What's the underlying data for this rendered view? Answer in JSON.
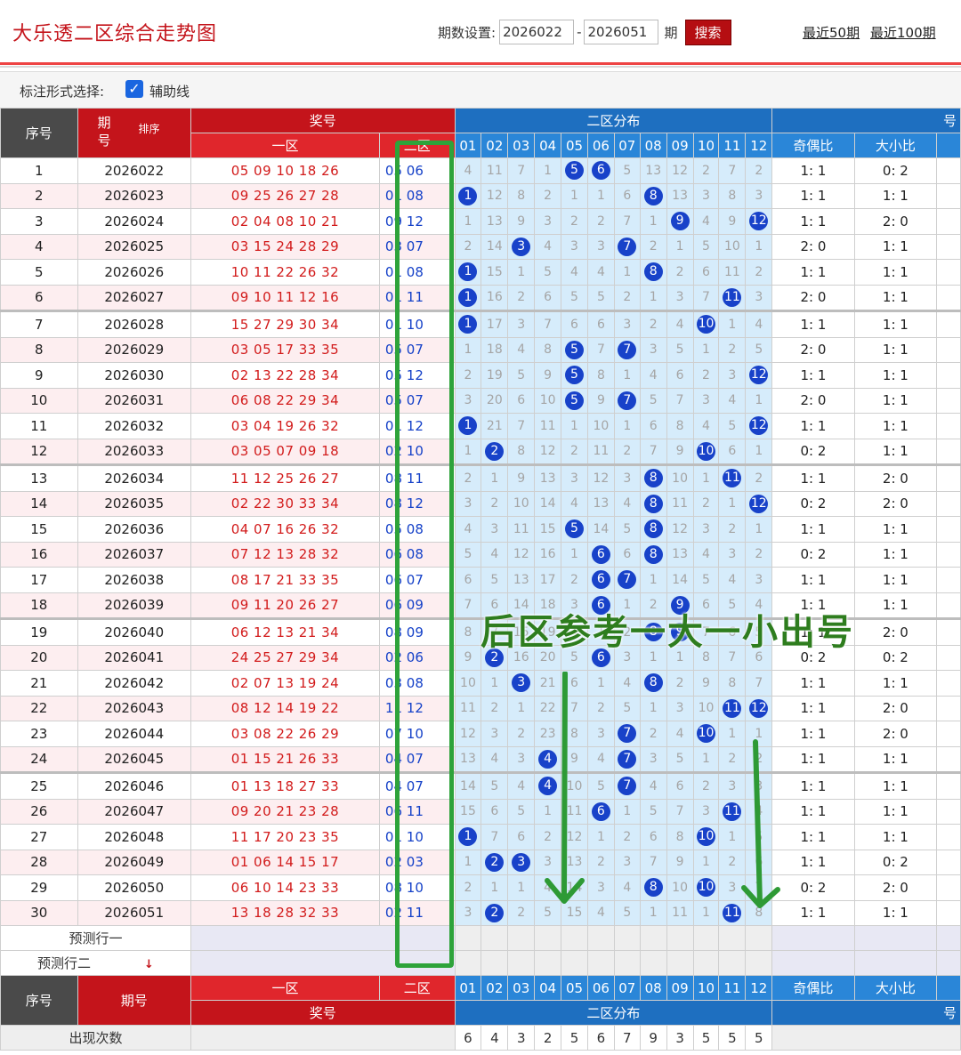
{
  "header": {
    "title": "大乐透二区综合走势图",
    "period_label": "期数设置:",
    "period_from": "2026022",
    "period_to": "2026051",
    "period_unit": "期",
    "search_label": "搜索",
    "recent_50": "最近50期",
    "recent_100": "最近100期"
  },
  "options": {
    "label": "标注形式选择:",
    "aux_line_label": "辅助线",
    "aux_line_checked": true
  },
  "table_header": {
    "idx": "序号",
    "period": "期\n号",
    "sort": "排序",
    "prize": "奖号",
    "zone1": "一区",
    "zone2": "二区",
    "dist": "二区分布",
    "odd_even": "奇偶比",
    "big_small": "大小比",
    "cols": [
      "01",
      "02",
      "03",
      "04",
      "05",
      "06",
      "07",
      "08",
      "09",
      "10",
      "11",
      "12"
    ]
  },
  "rows": [
    {
      "idx": "1",
      "period": "2026022",
      "z1": "05 09 10 18 26",
      "z2": "05 06",
      "cells": [
        "4",
        "11",
        "7",
        "1",
        "5",
        "6",
        "5",
        "13",
        "12",
        "2",
        "7",
        "2"
      ],
      "hits": [
        5,
        6
      ],
      "oe": "1: 1",
      "bs": "0: 2"
    },
    {
      "idx": "2",
      "period": "2026023",
      "z1": "09 25 26 27 28",
      "z2": "01 08",
      "cells": [
        "1",
        "12",
        "8",
        "2",
        "1",
        "1",
        "6",
        "8",
        "13",
        "3",
        "8",
        "3"
      ],
      "hits": [
        1,
        8
      ],
      "oe": "1: 1",
      "bs": "1: 1"
    },
    {
      "idx": "3",
      "period": "2026024",
      "z1": "02 04 08 10 21",
      "z2": "09 12",
      "cells": [
        "1",
        "13",
        "9",
        "3",
        "2",
        "2",
        "7",
        "1",
        "9",
        "4",
        "9",
        "12"
      ],
      "hits": [
        9,
        12
      ],
      "oe": "1: 1",
      "bs": "2: 0"
    },
    {
      "idx": "4",
      "period": "2026025",
      "z1": "03 15 24 28 29",
      "z2": "03 07",
      "cells": [
        "2",
        "14",
        "3",
        "4",
        "3",
        "3",
        "7",
        "2",
        "1",
        "5",
        "10",
        "1"
      ],
      "hits": [
        3,
        7
      ],
      "oe": "2: 0",
      "bs": "1: 1"
    },
    {
      "idx": "5",
      "period": "2026026",
      "z1": "10 11 22 26 32",
      "z2": "01 08",
      "cells": [
        "1",
        "15",
        "1",
        "5",
        "4",
        "4",
        "1",
        "8",
        "2",
        "6",
        "11",
        "2"
      ],
      "hits": [
        1,
        8
      ],
      "oe": "1: 1",
      "bs": "1: 1"
    },
    {
      "idx": "6",
      "period": "2026027",
      "z1": "09 10 11 12 16",
      "z2": "01 11",
      "cells": [
        "1",
        "16",
        "2",
        "6",
        "5",
        "5",
        "2",
        "1",
        "3",
        "7",
        "11",
        "3"
      ],
      "hits": [
        1,
        11
      ],
      "oe": "2: 0",
      "bs": "1: 1"
    },
    {
      "idx": "7",
      "period": "2026028",
      "z1": "15 27 29 30 34",
      "z2": "01 10",
      "cells": [
        "1",
        "17",
        "3",
        "7",
        "6",
        "6",
        "3",
        "2",
        "4",
        "10",
        "1",
        "4"
      ],
      "hits": [
        1,
        10
      ],
      "oe": "1: 1",
      "bs": "1: 1"
    },
    {
      "idx": "8",
      "period": "2026029",
      "z1": "03 05 17 33 35",
      "z2": "05 07",
      "cells": [
        "1",
        "18",
        "4",
        "8",
        "5",
        "7",
        "7",
        "3",
        "5",
        "1",
        "2",
        "5"
      ],
      "hits": [
        5,
        7
      ],
      "oe": "2: 0",
      "bs": "1: 1"
    },
    {
      "idx": "9",
      "period": "2026030",
      "z1": "02 13 22 28 34",
      "z2": "05 12",
      "cells": [
        "2",
        "19",
        "5",
        "9",
        "5",
        "8",
        "1",
        "4",
        "6",
        "2",
        "3",
        "12"
      ],
      "hits": [
        5,
        12
      ],
      "oe": "1: 1",
      "bs": "1: 1"
    },
    {
      "idx": "10",
      "period": "2026031",
      "z1": "06 08 22 29 34",
      "z2": "05 07",
      "cells": [
        "3",
        "20",
        "6",
        "10",
        "5",
        "9",
        "7",
        "5",
        "7",
        "3",
        "4",
        "1"
      ],
      "hits": [
        5,
        7
      ],
      "oe": "2: 0",
      "bs": "1: 1"
    },
    {
      "idx": "11",
      "period": "2026032",
      "z1": "03 04 19 26 32",
      "z2": "01 12",
      "cells": [
        "1",
        "21",
        "7",
        "11",
        "1",
        "10",
        "1",
        "6",
        "8",
        "4",
        "5",
        "12"
      ],
      "hits": [
        1,
        12
      ],
      "oe": "1: 1",
      "bs": "1: 1"
    },
    {
      "idx": "12",
      "period": "2026033",
      "z1": "03 05 07 09 18",
      "z2": "02 10",
      "cells": [
        "1",
        "2",
        "8",
        "12",
        "2",
        "11",
        "2",
        "7",
        "9",
        "10",
        "6",
        "1"
      ],
      "hits": [
        2,
        10
      ],
      "oe": "0: 2",
      "bs": "1: 1"
    },
    {
      "idx": "13",
      "period": "2026034",
      "z1": "11 12 25 26 27",
      "z2": "08 11",
      "cells": [
        "2",
        "1",
        "9",
        "13",
        "3",
        "12",
        "3",
        "8",
        "10",
        "1",
        "11",
        "2"
      ],
      "hits": [
        8,
        11
      ],
      "oe": "1: 1",
      "bs": "2: 0"
    },
    {
      "idx": "14",
      "period": "2026035",
      "z1": "02 22 30 33 34",
      "z2": "08 12",
      "cells": [
        "3",
        "2",
        "10",
        "14",
        "4",
        "13",
        "4",
        "8",
        "11",
        "2",
        "1",
        "12"
      ],
      "hits": [
        8,
        12
      ],
      "oe": "0: 2",
      "bs": "2: 0"
    },
    {
      "idx": "15",
      "period": "2026036",
      "z1": "04 07 16 26 32",
      "z2": "05 08",
      "cells": [
        "4",
        "3",
        "11",
        "15",
        "5",
        "14",
        "5",
        "8",
        "12",
        "3",
        "2",
        "1"
      ],
      "hits": [
        5,
        8
      ],
      "oe": "1: 1",
      "bs": "1: 1"
    },
    {
      "idx": "16",
      "period": "2026037",
      "z1": "07 12 13 28 32",
      "z2": "06 08",
      "cells": [
        "5",
        "4",
        "12",
        "16",
        "1",
        "6",
        "6",
        "8",
        "13",
        "4",
        "3",
        "2"
      ],
      "hits": [
        6,
        8
      ],
      "oe": "0: 2",
      "bs": "1: 1"
    },
    {
      "idx": "17",
      "period": "2026038",
      "z1": "08 17 21 33 35",
      "z2": "06 07",
      "cells": [
        "6",
        "5",
        "13",
        "17",
        "2",
        "6",
        "7",
        "1",
        "14",
        "5",
        "4",
        "3"
      ],
      "hits": [
        6,
        7
      ],
      "oe": "1: 1",
      "bs": "1: 1"
    },
    {
      "idx": "18",
      "period": "2026039",
      "z1": "09 11 20 26 27",
      "z2": "06 09",
      "cells": [
        "7",
        "6",
        "14",
        "18",
        "3",
        "6",
        "1",
        "2",
        "9",
        "6",
        "5",
        "4"
      ],
      "hits": [
        6,
        9
      ],
      "oe": "1: 1",
      "bs": "1: 1"
    },
    {
      "idx": "19",
      "period": "2026040",
      "z1": "06 12 13 21 34",
      "z2": "08 09",
      "cells": [
        "8",
        "7",
        "15",
        "19",
        "4",
        "1",
        "2",
        "8",
        "9",
        "7",
        "6",
        "5"
      ],
      "hits": [
        8,
        9
      ],
      "oe": "1: 1",
      "bs": "2: 0"
    },
    {
      "idx": "20",
      "period": "2026041",
      "z1": "24 25 27 29 34",
      "z2": "02 06",
      "cells": [
        "9",
        "2",
        "16",
        "20",
        "5",
        "6",
        "3",
        "1",
        "1",
        "8",
        "7",
        "6"
      ],
      "hits": [
        2,
        6
      ],
      "oe": "0: 2",
      "bs": "0: 2"
    },
    {
      "idx": "21",
      "period": "2026042",
      "z1": "02 07 13 19 24",
      "z2": "03 08",
      "cells": [
        "10",
        "1",
        "3",
        "21",
        "6",
        "1",
        "4",
        "8",
        "2",
        "9",
        "8",
        "7"
      ],
      "hits": [
        3,
        8
      ],
      "oe": "1: 1",
      "bs": "1: 1"
    },
    {
      "idx": "22",
      "period": "2026043",
      "z1": "08 12 14 19 22",
      "z2": "11 12",
      "cells": [
        "11",
        "2",
        "1",
        "22",
        "7",
        "2",
        "5",
        "1",
        "3",
        "10",
        "11",
        "12"
      ],
      "hits": [
        11,
        12
      ],
      "oe": "1: 1",
      "bs": "2: 0"
    },
    {
      "idx": "23",
      "period": "2026044",
      "z1": "03 08 22 26 29",
      "z2": "07 10",
      "cells": [
        "12",
        "3",
        "2",
        "23",
        "8",
        "3",
        "7",
        "2",
        "4",
        "10",
        "1",
        "1"
      ],
      "hits": [
        7,
        10
      ],
      "oe": "1: 1",
      "bs": "2: 0"
    },
    {
      "idx": "24",
      "period": "2026045",
      "z1": "01 15 21 26 33",
      "z2": "04 07",
      "cells": [
        "13",
        "4",
        "3",
        "4",
        "9",
        "4",
        "7",
        "3",
        "5",
        "1",
        "2",
        "2"
      ],
      "hits": [
        4,
        7
      ],
      "oe": "1: 1",
      "bs": "1: 1"
    },
    {
      "idx": "25",
      "period": "2026046",
      "z1": "01 13 18 27 33",
      "z2": "04 07",
      "cells": [
        "14",
        "5",
        "4",
        "4",
        "10",
        "5",
        "7",
        "4",
        "6",
        "2",
        "3",
        "3"
      ],
      "hits": [
        4,
        7
      ],
      "oe": "1: 1",
      "bs": "1: 1"
    },
    {
      "idx": "26",
      "period": "2026047",
      "z1": "09 20 21 23 28",
      "z2": "06 11",
      "cells": [
        "15",
        "6",
        "5",
        "1",
        "11",
        "6",
        "1",
        "5",
        "7",
        "3",
        "11",
        "4"
      ],
      "hits": [
        6,
        11
      ],
      "oe": "1: 1",
      "bs": "1: 1"
    },
    {
      "idx": "27",
      "period": "2026048",
      "z1": "11 17 20 23 35",
      "z2": "01 10",
      "cells": [
        "1",
        "7",
        "6",
        "2",
        "12",
        "1",
        "2",
        "6",
        "8",
        "10",
        "1",
        "5"
      ],
      "hits": [
        1,
        10
      ],
      "oe": "1: 1",
      "bs": "1: 1"
    },
    {
      "idx": "28",
      "period": "2026049",
      "z1": "01 06 14 15 17",
      "z2": "02 03",
      "cells": [
        "1",
        "2",
        "3",
        "3",
        "13",
        "2",
        "3",
        "7",
        "9",
        "1",
        "2",
        "6"
      ],
      "hits": [
        2,
        3
      ],
      "oe": "1: 1",
      "bs": "0: 2"
    },
    {
      "idx": "29",
      "period": "2026050",
      "z1": "06 10 14 23 33",
      "z2": "08 10",
      "cells": [
        "2",
        "1",
        "1",
        "4",
        "14",
        "3",
        "4",
        "8",
        "10",
        "10",
        "3",
        "7"
      ],
      "hits": [
        8,
        10
      ],
      "oe": "0: 2",
      "bs": "2: 0"
    },
    {
      "idx": "30",
      "period": "2026051",
      "z1": "13 18 28 32 33",
      "z2": "02 11",
      "cells": [
        "3",
        "2",
        "2",
        "5",
        "15",
        "4",
        "5",
        "1",
        "11",
        "1",
        "11",
        "8"
      ],
      "hits": [
        2,
        11
      ],
      "oe": "1: 1",
      "bs": "1: 1"
    }
  ],
  "predict": {
    "row1": "预测行一",
    "row2": "预测行二"
  },
  "footer": {
    "idx": "序号",
    "period": "期号",
    "zone1": "一区",
    "zone2": "二区",
    "prize": "奖号",
    "dist": "二区分布",
    "odd_even": "奇偶比",
    "big_small": "大小比",
    "count_label": "出现次数",
    "counts": [
      "6",
      "4",
      "3",
      "2",
      "5",
      "6",
      "7",
      "9",
      "3",
      "5",
      "5",
      "5"
    ]
  },
  "annotation": "后区参考一大一小出号",
  "colors": {
    "brand_red": "#c4141b",
    "ball_blue": "#1842c9",
    "annotation_green": "#2e7d1e",
    "box_green": "#2ea33a"
  }
}
